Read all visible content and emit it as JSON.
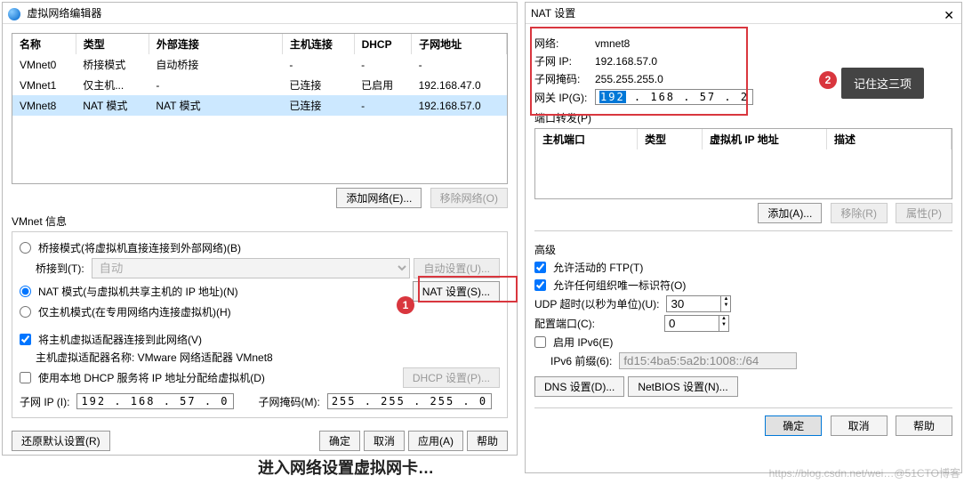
{
  "leftDialog": {
    "title": "虚拟网络编辑器",
    "table": {
      "headers": [
        "名称",
        "类型",
        "外部连接",
        "主机连接",
        "DHCP",
        "子网地址"
      ],
      "rows": [
        [
          "VMnet0",
          "桥接模式",
          "自动桥接",
          "-",
          "-",
          "-"
        ],
        [
          "VMnet1",
          "仅主机...",
          "-",
          "已连接",
          "已启用",
          "192.168.47.0"
        ],
        [
          "VMnet8",
          "NAT 模式",
          "NAT 模式",
          "已连接",
          "-",
          "192.168.57.0"
        ]
      ]
    },
    "btnAddNet": "添加网络(E)...",
    "btnRemoveNet": "移除网络(O)",
    "vmnetInfoLabel": "VMnet 信息",
    "radioBridge": "桥接模式(将虚拟机直接连接到外部网络)(B)",
    "bridgeToLabel": "桥接到(T):",
    "bridgeSelect": "自动",
    "btnAutoSet": "自动设置(U)...",
    "radioNat": "NAT 模式(与虚拟机共享主机的 IP 地址)(N)",
    "btnNatSet": "NAT 设置(S)...",
    "radioHostOnly": "仅主机模式(在专用网络内连接虚拟机)(H)",
    "chkConnectHost": "将主机虚拟适配器连接到此网络(V)",
    "hostAdapterLabel": "主机虚拟适配器名称: VMware 网络适配器 VMnet8",
    "chkLocalDhcp": "使用本地 DHCP 服务将 IP 地址分配给虚拟机(D)",
    "btnDhcpSet": "DHCP 设置(P)...",
    "subnetIpLabel": "子网 IP (I):",
    "subnetIp": "192 . 168 .  57  .  0",
    "subnetMaskLabel": "子网掩码(M):",
    "subnetMask": "255 . 255 . 255 .  0",
    "btnRestore": "还原默认设置(R)",
    "btnOk": "确定",
    "btnCancel": "取消",
    "btnApply": "应用(A)",
    "btnHelp": "帮助"
  },
  "rightDialog": {
    "title": "NAT 设置",
    "netLabel": "网络:",
    "netVal": "vmnet8",
    "subIpLabel": "子网 IP:",
    "subIpVal": "192.168.57.0",
    "subMaskLabel": "子网掩码:",
    "subMaskVal": "255.255.255.0",
    "gwLabel": "网关 IP(G):",
    "gwVal": "192 . 168 .  57  .  2",
    "gwSelected": "192",
    "pfLabel": "端口转发(P)",
    "pfHeaders": [
      "主机端口",
      "类型",
      "虚拟机 IP 地址",
      "描述"
    ],
    "btnAdd": "添加(A)...",
    "btnRemove": "移除(R)",
    "btnProp": "属性(P)",
    "advLabel": "高级",
    "chkFtp": "允许活动的 FTP(T)",
    "chkUid": "允许任何组织唯一标识符(O)",
    "udpLabel": "UDP 超时(以秒为单位)(U):",
    "udpVal": "30",
    "cfgPortLabel": "配置端口(C):",
    "cfgPortVal": "0",
    "chkIpv6": "启用 IPv6(E)",
    "ipv6PrefixLabel": "IPv6 前缀(6):",
    "ipv6PrefixVal": "fd15:4ba5:5a2b:1008::/64",
    "btnDns": "DNS 设置(D)...",
    "btnNetbios": "NetBIOS 设置(N)...",
    "btnOk": "确定",
    "btnCancel": "取消",
    "btnHelp": "帮助"
  },
  "annotations": {
    "marker1": "1",
    "marker2": "2",
    "tooltip": "记住这三项"
  },
  "footer": "进入网络设置虚拟网卡…",
  "watermark": "https://blog.csdn.net/wei…@51CTO博客"
}
